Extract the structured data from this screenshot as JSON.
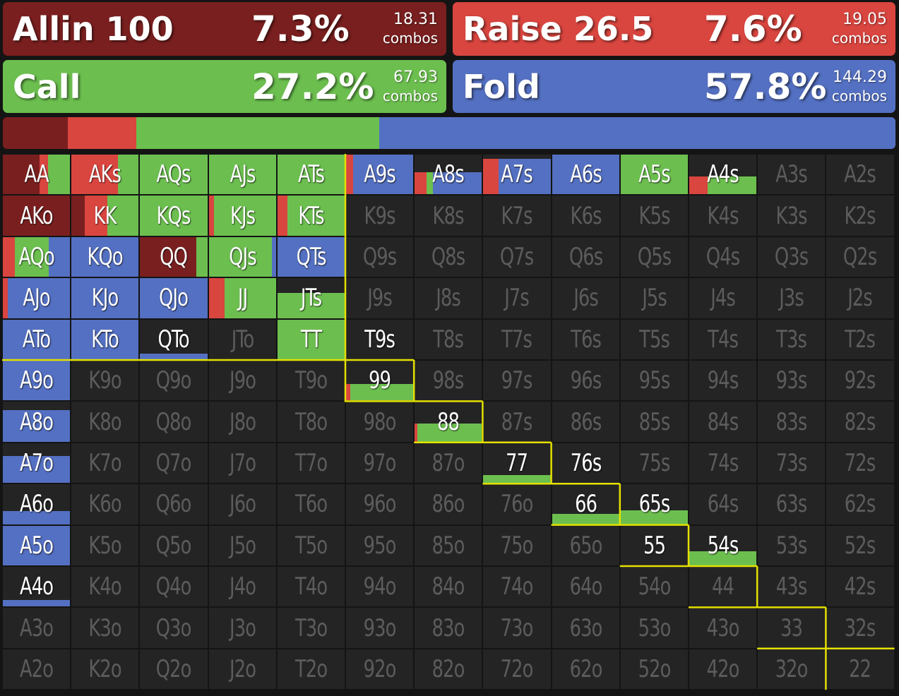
{
  "colors": {
    "allin": "#7a1f1f",
    "raise": "#d9453f",
    "call": "#6cbf4f",
    "fold": "#5470c2",
    "empty": "#242424",
    "outline": "#e4e000"
  },
  "actions": [
    {
      "key": "allin",
      "label": "Allin 100",
      "pct": "7.3%",
      "combos": "18.31",
      "combos_label": "combos"
    },
    {
      "key": "raise",
      "label": "Raise 26.5",
      "pct": "7.6%",
      "combos": "19.05",
      "combos_label": "combos"
    },
    {
      "key": "call",
      "label": "Call",
      "pct": "27.2%",
      "combos": "67.93",
      "combos_label": "combos"
    },
    {
      "key": "fold",
      "label": "Fold",
      "pct": "57.8%",
      "combos": "144.29",
      "combos_label": "combos"
    }
  ],
  "frequency_bar": [
    {
      "key": "allin",
      "value": 7.3
    },
    {
      "key": "raise",
      "value": 7.6
    },
    {
      "key": "call",
      "value": 27.2
    },
    {
      "key": "fold",
      "value": 57.8
    }
  ],
  "ranks": [
    "A",
    "K",
    "Q",
    "J",
    "T",
    "9",
    "8",
    "7",
    "6",
    "5",
    "4",
    "3",
    "2"
  ],
  "hands": {
    "AA": {
      "allin": 0.55,
      "raise": 0.12,
      "call": 0.33,
      "fold": 0
    },
    "AKs": {
      "allin": 0,
      "raise": 0.69,
      "call": 0.31,
      "fold": 0
    },
    "AQs": {
      "allin": 0,
      "raise": 0,
      "call": 1,
      "fold": 0
    },
    "AJs": {
      "allin": 0,
      "raise": 0,
      "call": 1,
      "fold": 0
    },
    "ATs": {
      "allin": 0,
      "raise": 0,
      "call": 1,
      "fold": 0
    },
    "A9s": {
      "allin": 0,
      "raise": 0.1,
      "call": 0,
      "fold": 0.9
    },
    "A8s": {
      "allin": 0,
      "raise": 0.1,
      "call": 0.05,
      "fold": 0.4,
      "empty": 0.45
    },
    "A7s": {
      "allin": 0,
      "raise": 0.2,
      "call": 0,
      "fold": 0.7,
      "empty": 0.1
    },
    "A6s": {
      "allin": 0,
      "raise": 0,
      "call": 0,
      "fold": 1
    },
    "A5s": {
      "allin": 0,
      "raise": 0,
      "call": 1,
      "fold": 0
    },
    "A4s": {
      "allin": 0,
      "raise": 0.27,
      "call": 0.73,
      "fold": 0,
      "empty": 0.55
    },
    "AKo": {
      "allin": 1,
      "raise": 0,
      "call": 0,
      "fold": 0
    },
    "KK": {
      "allin": 0.2,
      "raise": 0.33,
      "call": 0.47,
      "fold": 0
    },
    "KQs": {
      "allin": 0,
      "raise": 0,
      "call": 1,
      "fold": 0
    },
    "KJs": {
      "allin": 0,
      "raise": 0.08,
      "call": 0.92,
      "fold": 0
    },
    "KTs": {
      "allin": 0,
      "raise": 0.15,
      "call": 0.85,
      "fold": 0
    },
    "AQo": {
      "allin": 0,
      "raise": 0.18,
      "call": 0.5,
      "fold": 0.32
    },
    "KQo": {
      "allin": 0,
      "raise": 0,
      "call": 0,
      "fold": 1
    },
    "QQ": {
      "allin": 0.84,
      "raise": 0,
      "call": 0.16,
      "fold": 0
    },
    "QJs": {
      "allin": 0,
      "raise": 0,
      "call": 0.94,
      "fold": 0.06
    },
    "QTs": {
      "allin": 0,
      "raise": 0,
      "call": 0,
      "fold": 1
    },
    "AJo": {
      "allin": 0,
      "raise": 0.07,
      "call": 0,
      "fold": 0.93
    },
    "KJo": {
      "allin": 0,
      "raise": 0,
      "call": 0,
      "fold": 1
    },
    "QJo": {
      "allin": 0,
      "raise": 0,
      "call": 0,
      "fold": 1
    },
    "JJ": {
      "allin": 0,
      "raise": 0.24,
      "call": 0.76,
      "fold": 0
    },
    "JTs": {
      "allin": 0,
      "raise": 0,
      "call": 1,
      "fold": 0,
      "empty": 0.37
    },
    "ATo": {
      "allin": 0,
      "raise": 0,
      "call": 0,
      "fold": 1
    },
    "KTo": {
      "allin": 0,
      "raise": 0,
      "call": 0,
      "fold": 1
    },
    "QTo": {
      "allin": 0,
      "raise": 0,
      "call": 0,
      "fold": 1,
      "empty": 0.86
    },
    "TT": {
      "allin": 0,
      "raise": 0,
      "call": 0.95,
      "fold": 0,
      "empty": 0,
      "raise_left": 0.05
    },
    "T9s": {
      "allin": 0,
      "raise": 0,
      "call": 0,
      "fold": 0,
      "empty": 1
    },
    "A9o": {
      "allin": 0,
      "raise": 0,
      "call": 0,
      "fold": 1
    },
    "99": {
      "allin": 0,
      "raise": 0.06,
      "call": 0.94,
      "fold": 0,
      "empty": 0.58
    },
    "A8o": {
      "allin": 0,
      "raise": 0,
      "call": 0,
      "fold": 1,
      "empty": 0.2
    },
    "88": {
      "allin": 0,
      "raise": 0.04,
      "call": 0.96,
      "fold": 0,
      "empty": 0.55
    },
    "A7o": {
      "allin": 0,
      "raise": 0,
      "call": 0,
      "fold": 1,
      "empty": 0.33
    },
    "77": {
      "allin": 0,
      "raise": 0,
      "call": 1,
      "fold": 0,
      "empty": 0.8
    },
    "76s": {
      "allin": 0,
      "raise": 0,
      "call": 0,
      "fold": 0,
      "empty": 1
    },
    "A6o": {
      "allin": 0,
      "raise": 0,
      "call": 0,
      "fold": 1,
      "empty": 0.67
    },
    "66": {
      "allin": 0,
      "raise": 0,
      "call": 1,
      "fold": 0,
      "empty": 0.74
    },
    "65s": {
      "allin": 0,
      "raise": 0,
      "call": 1,
      "fold": 0,
      "empty": 0.66
    },
    "A5o": {
      "allin": 0,
      "raise": 0,
      "call": 0,
      "fold": 1
    },
    "55": {
      "allin": 0,
      "raise": 0,
      "call": 0,
      "fold": 0,
      "empty": 1
    },
    "54s": {
      "allin": 0,
      "raise": 0,
      "call": 1,
      "fold": 0,
      "empty": 0.64
    },
    "A4o": {
      "allin": 0,
      "raise": 0,
      "call": 0,
      "fold": 1,
      "empty": 0.84
    }
  },
  "range_outline": [
    [
      5,
      1
    ],
    [
      6,
      2
    ],
    [
      7,
      3
    ],
    [
      8,
      4
    ],
    [
      9,
      5
    ],
    [
      10,
      6
    ],
    [
      11,
      7
    ],
    [
      12,
      8
    ],
    [
      13,
      9
    ],
    [
      13,
      10
    ],
    [
      13,
      11
    ],
    [
      13,
      12
    ],
    [
      13,
      13
    ]
  ]
}
